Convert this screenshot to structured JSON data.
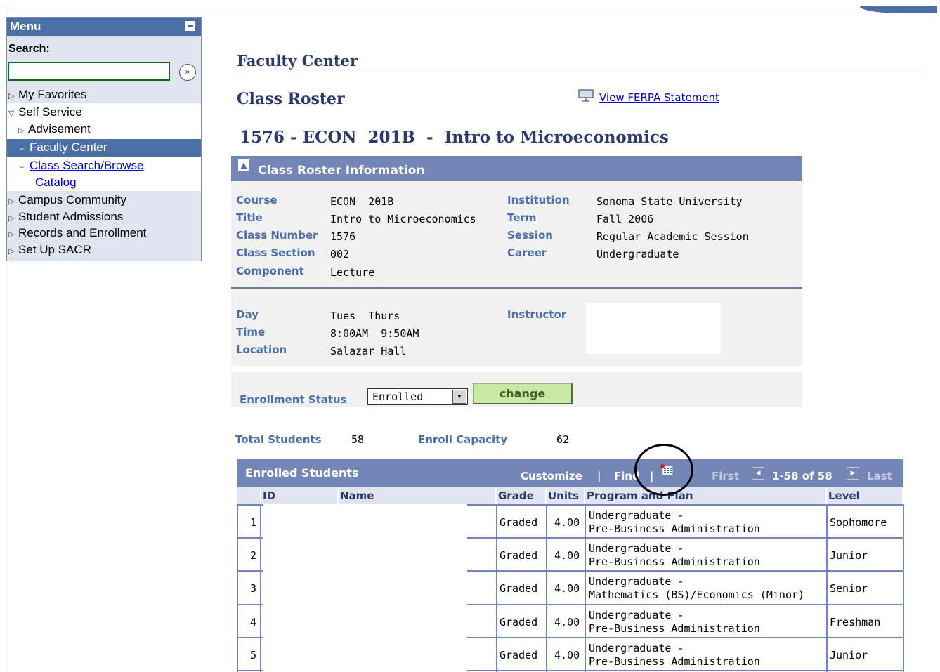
{
  "menu": {
    "title": "Menu",
    "search_label": "Search:",
    "search_value": "",
    "go_icon": "»",
    "items": [
      {
        "label": "My Favorites",
        "icon": "triangle-right"
      },
      {
        "label": "Self Service",
        "icon": "triangle-down"
      },
      {
        "label": "Advisement",
        "icon": "triangle-right"
      },
      {
        "label": "Faculty Center",
        "icon": "dash"
      },
      {
        "label": "Class Search/Browse",
        "icon": "dash"
      },
      {
        "label": "Catalog"
      },
      {
        "label": "Campus Community",
        "icon": "triangle-right"
      },
      {
        "label": "Student Admissions",
        "icon": "triangle-right"
      },
      {
        "label": "Records and Enrollment",
        "icon": "triangle-right"
      },
      {
        "label": "Set Up SACR",
        "icon": "triangle-right"
      }
    ]
  },
  "page": {
    "faculty_center": "Faculty Center",
    "class_roster": "Class Roster",
    "ferpa_link": "View FERPA Statement",
    "class_title": "1576 - ECON  201B  -  Intro to Microeconomics"
  },
  "info": {
    "header": "Class Roster Information",
    "course_label": "Course",
    "course": "ECON  201B",
    "title_label": "Title",
    "title": "Intro to Microeconomics",
    "class_number_label": "Class Number",
    "class_number": "1576",
    "class_section_label": "Class Section",
    "class_section": "002",
    "component_label": "Component",
    "component": "Lecture",
    "institution_label": "Institution",
    "institution": "Sonoma State University",
    "term_label": "Term",
    "term": "Fall 2006",
    "session_label": "Session",
    "session": "Regular Academic Session",
    "career_label": "Career",
    "career": "Undergraduate",
    "day_label": "Day",
    "day": "Tues  Thurs",
    "time_label": "Time",
    "time": "8:00AM  9:50AM",
    "location_label": "Location",
    "location": "Salazar Hall",
    "instructor_label": "Instructor",
    "instructor": ""
  },
  "enrollment": {
    "status_label": "Enrollment Status",
    "status_value": "Enrolled",
    "change_button": "change",
    "total_label": "Total Students",
    "total": "58",
    "capacity_label": "Enroll Capacity",
    "capacity": "62"
  },
  "grid": {
    "title": "Enrolled Students",
    "customize": "Customize",
    "find": "Find",
    "first": "First",
    "range": "1-58 of 58",
    "last": "Last",
    "columns": [
      "ID",
      "Name",
      "Grade",
      "Units",
      "Program and Plan",
      "Level"
    ],
    "rows": [
      {
        "num": "1",
        "grade": "Graded",
        "units": "4.00",
        "program": "Undergraduate -",
        "plan": "Pre-Business Administration",
        "level": "Sophomore"
      },
      {
        "num": "2",
        "grade": "Graded",
        "units": "4.00",
        "program": "Undergraduate -",
        "plan": "Pre-Business Administration",
        "level": "Junior"
      },
      {
        "num": "3",
        "grade": "Graded",
        "units": "4.00",
        "program": "Undergraduate -",
        "plan": "Mathematics (BS)/Economics (Minor)",
        "level": "Senior"
      },
      {
        "num": "4",
        "grade": "Graded",
        "units": "4.00",
        "program": "Undergraduate -",
        "plan": "Pre-Business Administration",
        "level": "Freshman"
      },
      {
        "num": "5",
        "grade": "Graded",
        "units": "4.00",
        "program": "Undergraduate -",
        "plan": "Pre-Business Administration",
        "level": "Junior"
      }
    ]
  },
  "colors": {
    "accent": "#4d6fa8",
    "header": "#7386b5",
    "button": "#c9e8a8"
  }
}
